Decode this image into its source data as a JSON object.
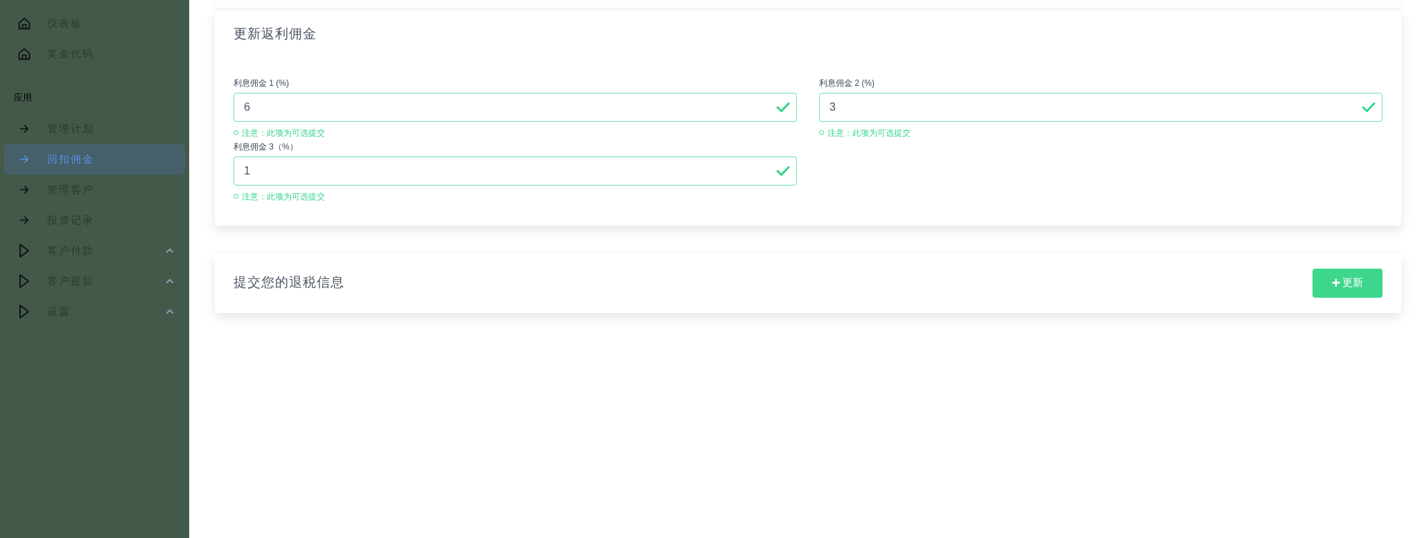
{
  "sidebar": {
    "items": [
      {
        "kind": "home",
        "label": "仪表板",
        "selected": false
      },
      {
        "kind": "home",
        "label": "奖金代码",
        "selected": false
      },
      {
        "kind": "section",
        "label": "应用"
      },
      {
        "kind": "link",
        "label": "管理计划",
        "selected": false
      },
      {
        "kind": "link",
        "label": "回扣佣金",
        "selected": true
      },
      {
        "kind": "link",
        "label": "管理客户",
        "selected": false
      },
      {
        "kind": "link",
        "label": "投资记录",
        "selected": false
      },
      {
        "kind": "group",
        "label": "客户付款",
        "selected": false
      },
      {
        "kind": "group",
        "label": "客户提款",
        "selected": false
      },
      {
        "kind": "group",
        "label": "设置",
        "selected": false
      }
    ]
  },
  "commission_card": {
    "title": "更新返利佣金",
    "fields": [
      {
        "label": "利息佣金 1 (%)",
        "value": "6",
        "valid": true,
        "hint": "注意：此项为可选提交"
      },
      {
        "label": "利息佣金 2 (%)",
        "value": "3",
        "valid": true,
        "hint": "注意：此项为可选提交"
      },
      {
        "label": "利息佣金 3（%）",
        "value": "1",
        "valid": true,
        "hint": "注意：此项为可选提交"
      }
    ]
  },
  "tax_card": {
    "title": "提交您的退税信息",
    "button": {
      "icon": "+",
      "label": "更新"
    }
  }
}
